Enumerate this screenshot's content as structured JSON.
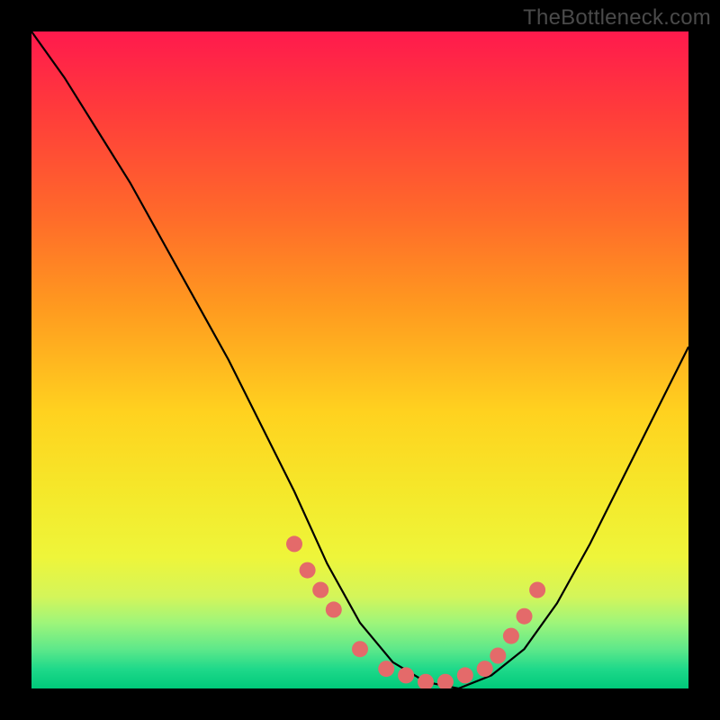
{
  "watermark": "TheBottleneck.com",
  "colors": {
    "background": "#000000",
    "gradient_top": "#ff1a4d",
    "gradient_bottom": "#00c97a",
    "curve": "#000000",
    "dots": "#e46a6a"
  },
  "chart_data": {
    "type": "line",
    "title": "",
    "xlabel": "",
    "ylabel": "",
    "xlim": [
      0,
      100
    ],
    "ylim": [
      0,
      100
    ],
    "series": [
      {
        "name": "bottleneck-curve",
        "x": [
          0,
          5,
          10,
          15,
          20,
          25,
          30,
          35,
          40,
          45,
          50,
          55,
          60,
          65,
          70,
          75,
          80,
          85,
          90,
          95,
          100
        ],
        "y": [
          100,
          93,
          85,
          77,
          68,
          59,
          50,
          40,
          30,
          19,
          10,
          4,
          1,
          0,
          2,
          6,
          13,
          22,
          32,
          42,
          52
        ]
      }
    ],
    "markers": {
      "name": "highlight-dots",
      "x": [
        40,
        42,
        44,
        46,
        50,
        54,
        57,
        60,
        63,
        66,
        69,
        71,
        73,
        75,
        77
      ],
      "y": [
        22,
        18,
        15,
        12,
        6,
        3,
        2,
        1,
        1,
        2,
        3,
        5,
        8,
        11,
        15
      ]
    }
  }
}
